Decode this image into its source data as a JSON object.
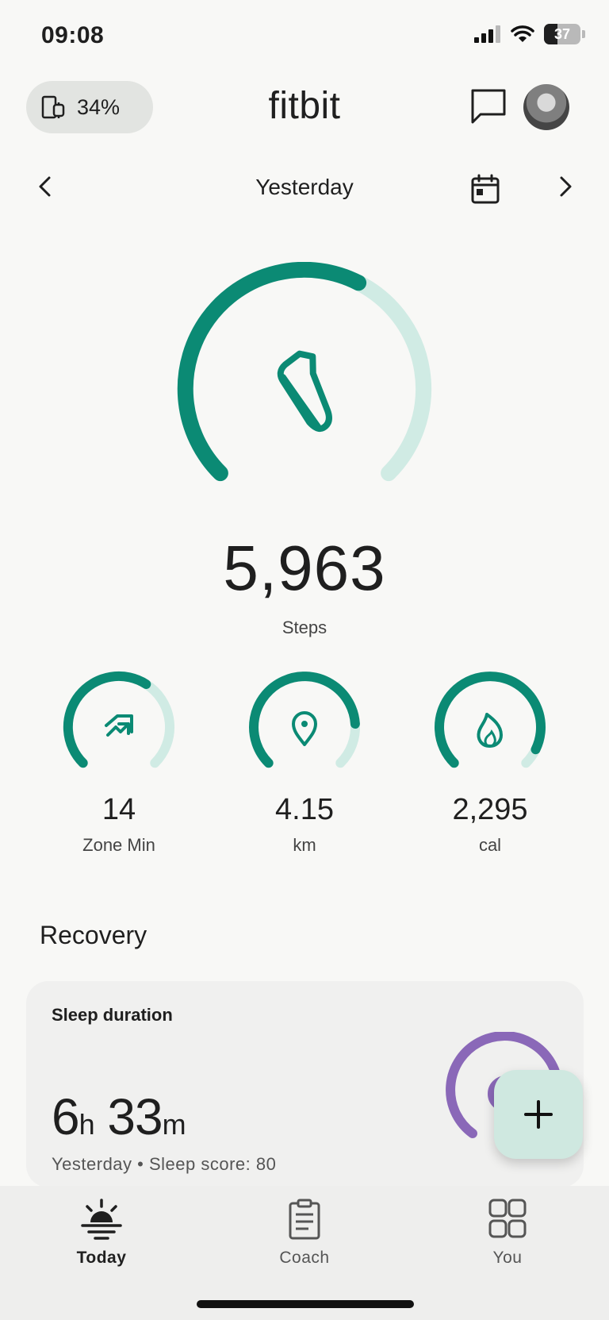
{
  "status_bar": {
    "time": "09:08",
    "battery": "37",
    "battery_level": 0.37
  },
  "header": {
    "device_battery": "34%",
    "brand": "fitbit"
  },
  "date_nav": {
    "label": "Yesterday"
  },
  "steps": {
    "value": "5,963",
    "label": "Steps",
    "progress": 0.6
  },
  "stats": [
    {
      "value": "14",
      "label": "Zone Min",
      "icon": "zone-arrow-icon",
      "progress": 0.62
    },
    {
      "value": "4.15",
      "label": "km",
      "icon": "location-pin-icon",
      "progress": 0.82
    },
    {
      "value": "2,295",
      "label": "cal",
      "icon": "flame-icon",
      "progress": 0.93
    }
  ],
  "recovery": {
    "title": "Recovery",
    "sleep_card": {
      "title": "Sleep duration",
      "hours": "6",
      "hours_unit": "h",
      "minutes": "33",
      "minutes_unit": "m",
      "subtitle": "Yesterday • Sleep score: 80"
    }
  },
  "nav": [
    {
      "label": "Today",
      "icon": "sunrise-icon",
      "active": true
    },
    {
      "label": "Coach",
      "icon": "clipboard-icon",
      "active": false
    },
    {
      "label": "You",
      "icon": "grid-icon",
      "active": false
    }
  ],
  "colors": {
    "accent": "#0b8a74",
    "accent_light": "#d0ebe4",
    "sleep": "#8a68b8",
    "fab": "#cfe8e0"
  }
}
